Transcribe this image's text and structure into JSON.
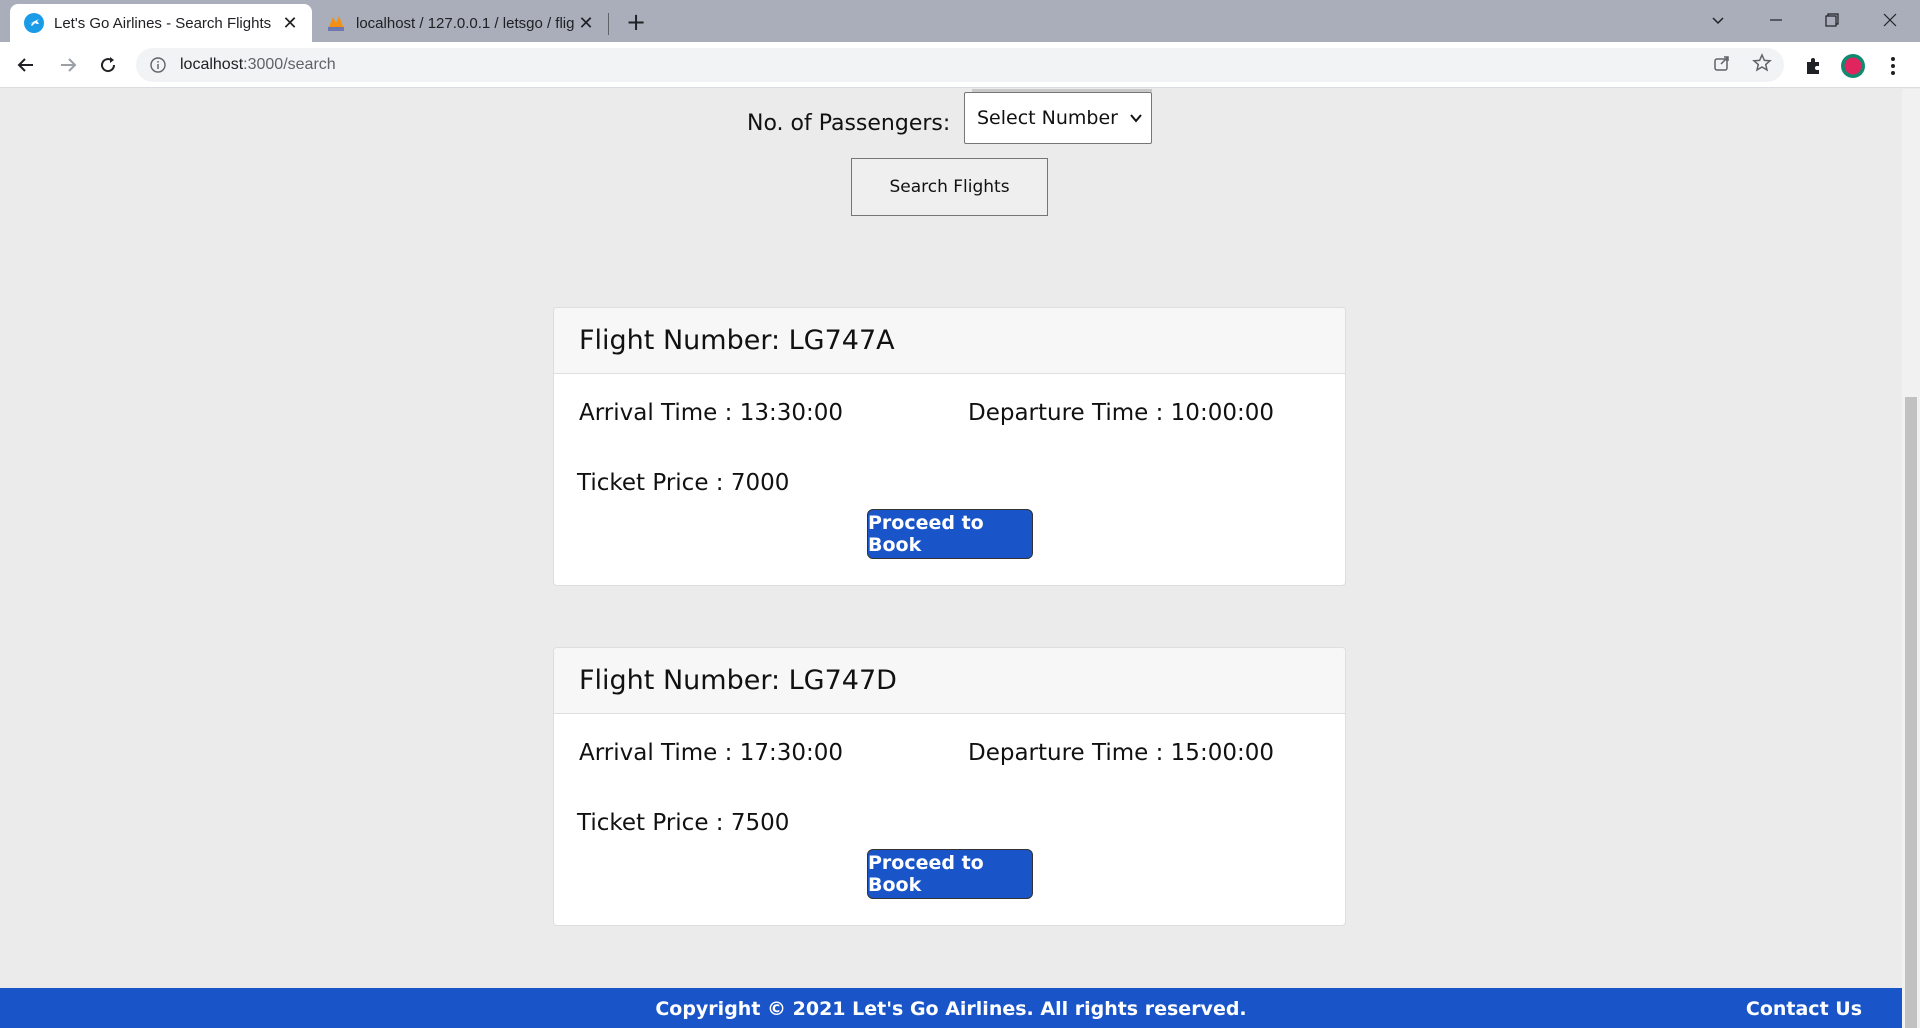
{
  "browser": {
    "tabs": [
      {
        "title": "Let's Go Airlines - Search Flights",
        "active": true
      },
      {
        "title": "localhost / 127.0.0.1 / letsgo / flig",
        "active": false
      }
    ],
    "close_glyph": "✕",
    "newtab_glyph": "+",
    "url_host": "localhost",
    "url_path": ":3000/search"
  },
  "search": {
    "passengers_label": "No. of Passengers:",
    "passengers_select_value": "Select Number",
    "search_button": "Search Flights"
  },
  "flights": [
    {
      "header": "Flight Number: LG747A",
      "arrival": "Arrival Time : 13:30:00",
      "departure": "Departure Time : 10:00:00",
      "price": "Ticket Price : 7000",
      "book_label": "Proceed to Book"
    },
    {
      "header": "Flight Number: LG747D",
      "arrival": "Arrival Time : 17:30:00",
      "departure": "Departure Time : 15:00:00",
      "price": "Ticket Price : 7500",
      "book_label": "Proceed to Book"
    }
  ],
  "footer": {
    "copyright": "Copyright © 2021 Let's Go Airlines. All rights reserved.",
    "contact": "Contact Us"
  },
  "colors": {
    "brand_blue": "#1955c8",
    "page_bg": "#ebebeb",
    "tabstrip_bg": "#a9aeba"
  }
}
